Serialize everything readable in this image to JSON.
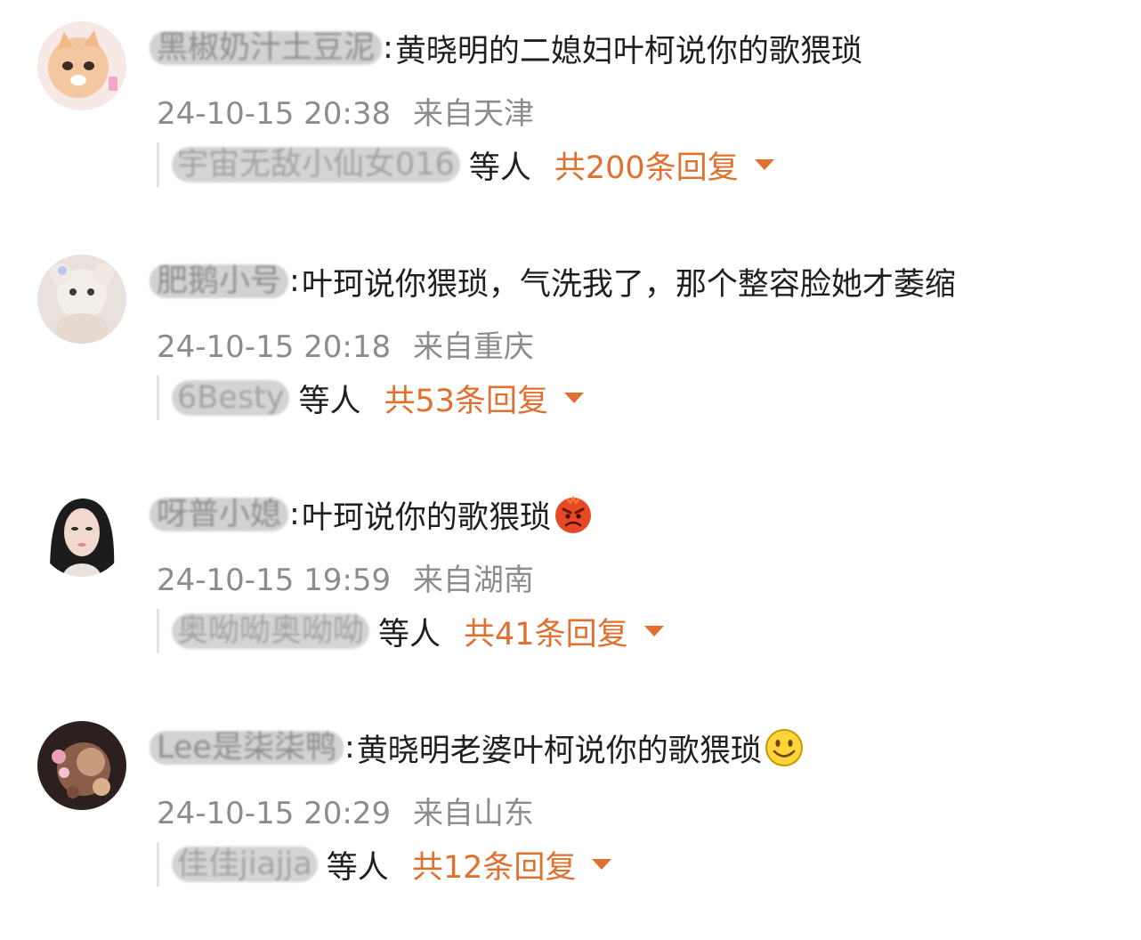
{
  "comments": [
    {
      "username": "黑椒奶汁土豆泥",
      "text": "黄晓明的二媳妇叶柯说你的歌猥琐",
      "emoji": "",
      "time": "24-10-15 20:38",
      "location": "来自天津",
      "reply_user": "宇宙无敌小仙女016",
      "reply_etc": "等人",
      "reply_count": "共200条回复"
    },
    {
      "username": "肥鹅小号",
      "text": "叶珂说你猥琐，气洗我了，那个整容脸她才萎缩",
      "emoji": "",
      "time": "24-10-15 20:18",
      "location": "来自重庆",
      "reply_user": "6Besty",
      "reply_etc": "等人",
      "reply_count": "共53条回复"
    },
    {
      "username": "呀普小媳",
      "text": "叶珂说你的歌猥琐",
      "emoji": "angry-face-icon",
      "time": "24-10-15 19:59",
      "location": "来自湖南",
      "reply_user": "奥呦呦奥呦呦",
      "reply_etc": "等人",
      "reply_count": "共41条回复"
    },
    {
      "username": "Lee是柒柒鸭",
      "text": "黄晓明老婆叶柯说你的歌猥琐",
      "emoji": "smile-face-icon",
      "time": "24-10-15 20:29",
      "location": "来自山东",
      "reply_user": "佳佳jiajja",
      "reply_etc": "等人",
      "reply_count": "共12条回复"
    }
  ],
  "colors": {
    "accent": "#e0702e",
    "meta_text": "#8c8c8c",
    "body_text": "#1f1f1f"
  }
}
